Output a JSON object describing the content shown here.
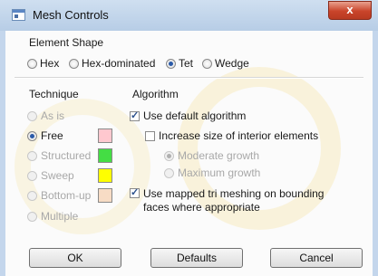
{
  "window": {
    "title": "Mesh Controls",
    "close_glyph": "x"
  },
  "element_shape": {
    "label": "Element Shape",
    "options": [
      {
        "label": "Hex",
        "checked": false
      },
      {
        "label": "Hex-dominated",
        "checked": false
      },
      {
        "label": "Tet",
        "checked": true
      },
      {
        "label": "Wedge",
        "checked": false
      }
    ]
  },
  "technique": {
    "label": "Technique",
    "options": [
      {
        "label": "As is",
        "checked": false,
        "enabled": false,
        "swatch": null
      },
      {
        "label": "Free",
        "checked": true,
        "enabled": true,
        "swatch": "#ffc8cf"
      },
      {
        "label": "Structured",
        "checked": false,
        "enabled": false,
        "swatch": "#44dd44"
      },
      {
        "label": "Sweep",
        "checked": false,
        "enabled": false,
        "swatch": "#ffff00"
      },
      {
        "label": "Bottom-up",
        "checked": false,
        "enabled": false,
        "swatch": "#f7dcc5"
      },
      {
        "label": "Multiple",
        "checked": false,
        "enabled": false,
        "swatch": null
      }
    ]
  },
  "algorithm": {
    "label": "Algorithm",
    "use_default": {
      "label": "Use default algorithm",
      "checked": true
    },
    "increase_size": {
      "label": "Increase size of interior elements",
      "checked": false
    },
    "growth": [
      {
        "label": "Moderate growth",
        "checked": true,
        "enabled": false
      },
      {
        "label": "Maximum growth",
        "checked": false,
        "enabled": false
      }
    ],
    "mapped_tri": {
      "label": "Use mapped tri meshing on bounding faces where appropriate",
      "line1": "Use mapped tri meshing on bounding",
      "line2": "faces where appropriate",
      "checked": true
    }
  },
  "buttons": {
    "ok": "OK",
    "defaults": "Defaults",
    "cancel": "Cancel"
  }
}
